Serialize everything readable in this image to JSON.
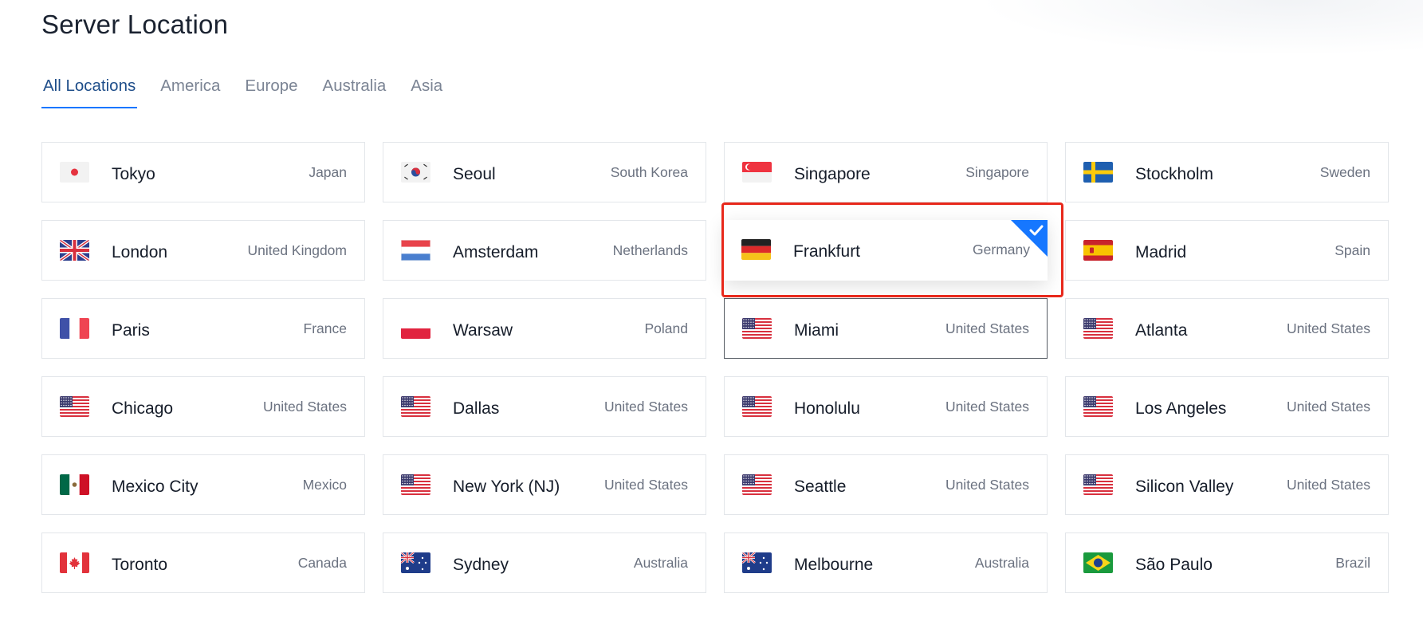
{
  "page": {
    "title": "Server Location"
  },
  "tabs": [
    {
      "label": "All Locations",
      "active": true
    },
    {
      "label": "America",
      "active": false
    },
    {
      "label": "Europe",
      "active": false
    },
    {
      "label": "Australia",
      "active": false
    },
    {
      "label": "Asia",
      "active": false
    }
  ],
  "locations": [
    {
      "city": "Tokyo",
      "country": "Japan",
      "flag": "jp-flag"
    },
    {
      "city": "Seoul",
      "country": "South Korea",
      "flag": "kr-flag"
    },
    {
      "city": "Singapore",
      "country": "Singapore",
      "flag": "sg-flag"
    },
    {
      "city": "Stockholm",
      "country": "Sweden",
      "flag": "se-flag"
    },
    {
      "city": "London",
      "country": "United Kingdom",
      "flag": "gb-flag"
    },
    {
      "city": "Amsterdam",
      "country": "Netherlands",
      "flag": "nl-flag"
    },
    {
      "city": "Frankfurt",
      "country": "Germany",
      "flag": "de-flag",
      "selected": true
    },
    {
      "city": "Madrid",
      "country": "Spain",
      "flag": "es-flag"
    },
    {
      "city": "Paris",
      "country": "France",
      "flag": "fr-flag"
    },
    {
      "city": "Warsaw",
      "country": "Poland",
      "flag": "pl-flag"
    },
    {
      "city": "Miami",
      "country": "United States",
      "flag": "us-flag",
      "hovered": true
    },
    {
      "city": "Atlanta",
      "country": "United States",
      "flag": "us-flag"
    },
    {
      "city": "Chicago",
      "country": "United States",
      "flag": "us-flag"
    },
    {
      "city": "Dallas",
      "country": "United States",
      "flag": "us-flag"
    },
    {
      "city": "Honolulu",
      "country": "United States",
      "flag": "us-flag"
    },
    {
      "city": "Los Angeles",
      "country": "United States",
      "flag": "us-flag"
    },
    {
      "city": "Mexico City",
      "country": "Mexico",
      "flag": "mx-flag"
    },
    {
      "city": "New York (NJ)",
      "country": "United States",
      "flag": "us-flag"
    },
    {
      "city": "Seattle",
      "country": "United States",
      "flag": "us-flag"
    },
    {
      "city": "Silicon Valley",
      "country": "United States",
      "flag": "us-flag"
    },
    {
      "city": "Toronto",
      "country": "Canada",
      "flag": "ca-flag"
    },
    {
      "city": "Sydney",
      "country": "Australia",
      "flag": "au-flag"
    },
    {
      "city": "Melbourne",
      "country": "Australia",
      "flag": "au-flag"
    },
    {
      "city": "São Paulo",
      "country": "Brazil",
      "flag": "br-flag"
    }
  ],
  "colors": {
    "accent": "#1677ff",
    "selection_check": "#1677ff",
    "annotation_box": "#e8281b",
    "title": "#1a2230",
    "muted_text": "#6b7280"
  }
}
